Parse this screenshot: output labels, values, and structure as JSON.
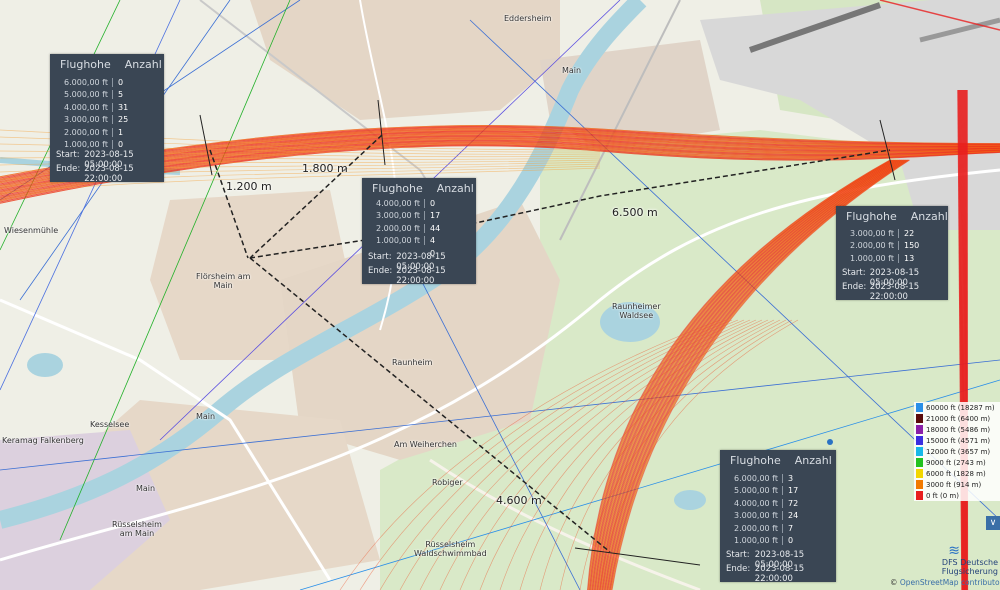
{
  "map": {
    "places": [
      {
        "id": "eddersheim",
        "label": "Eddersheim"
      },
      {
        "id": "floersheim",
        "label": "Flörsheim am\nMain"
      },
      {
        "id": "raunheim",
        "label": "Raunheim"
      },
      {
        "id": "ruesselsheim",
        "label": "Rüsselsheim\nam Main"
      },
      {
        "id": "keramag",
        "label": "Keramag Falkenberg"
      },
      {
        "id": "kesselsee",
        "label": "Kesselsee"
      },
      {
        "id": "wiesenmuehle",
        "label": "Wiesenmühle"
      },
      {
        "id": "raunheimer_waldsee",
        "label": "Raunheimer\nWaldsee"
      },
      {
        "id": "am_weiherchen",
        "label": "Am Weiherchen"
      },
      {
        "id": "robiger",
        "label": "Robiger"
      },
      {
        "id": "waldschwimmbad",
        "label": "Rüsselsheim\nWaldschwimmbad"
      },
      {
        "id": "main1",
        "label": "Main"
      },
      {
        "id": "main2",
        "label": "Main"
      },
      {
        "id": "main3",
        "label": "Main"
      }
    ],
    "distances": [
      "1.200 m",
      "1.800 m",
      "6.500 m",
      "4.600 m"
    ]
  },
  "panels": [
    {
      "header_alt": "Flughohe",
      "header_count": "Anzahl",
      "rows": [
        {
          "alt": "6.000,00 ft",
          "count": "0"
        },
        {
          "alt": "5.000,00 ft",
          "count": "5"
        },
        {
          "alt": "4.000,00 ft",
          "count": "31"
        },
        {
          "alt": "3.000,00 ft",
          "count": "25"
        },
        {
          "alt": "2.000,00 ft",
          "count": "1"
        },
        {
          "alt": "1.000,00 ft",
          "count": "0"
        }
      ],
      "start_label": "Start:",
      "start": "2023-08-15 05:00:00",
      "end_label": "Ende:",
      "end": "2023-08-15 22:00:00"
    },
    {
      "header_alt": "Flughohe",
      "header_count": "Anzahl",
      "rows": [
        {
          "alt": "4.000,00 ft",
          "count": "0"
        },
        {
          "alt": "3.000,00 ft",
          "count": "17"
        },
        {
          "alt": "2.000,00 ft",
          "count": "44"
        },
        {
          "alt": "1.000,00 ft",
          "count": "4"
        },
        {
          "alt": "",
          "count": "0"
        }
      ],
      "start_label": "Start:",
      "start": "2023-08-15 05:00:00",
      "end_label": "Ende:",
      "end": "2023-08-15 22:00:00"
    },
    {
      "header_alt": "Flughohe",
      "header_count": "Anzahl",
      "rows": [
        {
          "alt": "3.000,00 ft",
          "count": "22"
        },
        {
          "alt": "2.000,00 ft",
          "count": "150"
        },
        {
          "alt": "1.000,00 ft",
          "count": "13"
        }
      ],
      "start_label": "Start:",
      "start": "2023-08-15 05:00:00",
      "end_label": "Ende:",
      "end": "2023-08-15 22:00:00"
    },
    {
      "header_alt": "Flughohe",
      "header_count": "Anzahl",
      "rows": [
        {
          "alt": "6.000,00 ft",
          "count": "3"
        },
        {
          "alt": "5.000,00 ft",
          "count": "17"
        },
        {
          "alt": "4.000,00 ft",
          "count": "72"
        },
        {
          "alt": "3.000,00 ft",
          "count": "24"
        },
        {
          "alt": "2.000,00 ft",
          "count": "7"
        },
        {
          "alt": "1.000,00 ft",
          "count": "0"
        }
      ],
      "start_label": "Start:",
      "start": "2023-08-15 05:00:00",
      "end_label": "Ende:",
      "end": "2023-08-15 22:00:00"
    }
  ],
  "legend": [
    {
      "label": "60000 ft  (18287 m)",
      "color": "#2a8fe8"
    },
    {
      "label": "21000 ft  (6400 m)",
      "color": "#5a0b0b"
    },
    {
      "label": "18000 ft  (5486 m)",
      "color": "#8a1fa8"
    },
    {
      "label": "15000 ft  (4571 m)",
      "color": "#3b2ee0"
    },
    {
      "label": "12000 ft  (3657 m)",
      "color": "#18b8e8"
    },
    {
      "label": "9000 ft  (2743 m)",
      "color": "#23c21f"
    },
    {
      "label": "6000 ft  (1828 m)",
      "color": "#f2d600"
    },
    {
      "label": "3000 ft  (914 m)",
      "color": "#f27a00"
    },
    {
      "label": "0 ft  (0 m)",
      "color": "#e81e1e"
    }
  ],
  "branding": {
    "dfs": "DFS Deutsche Flugsicherung",
    "dfs_logo_icon": "dfs-logo-icon",
    "osm_prefix": "© ",
    "osm_link": "OpenStreetMap contributors."
  },
  "controls": {
    "collapse_icon": "∨"
  }
}
